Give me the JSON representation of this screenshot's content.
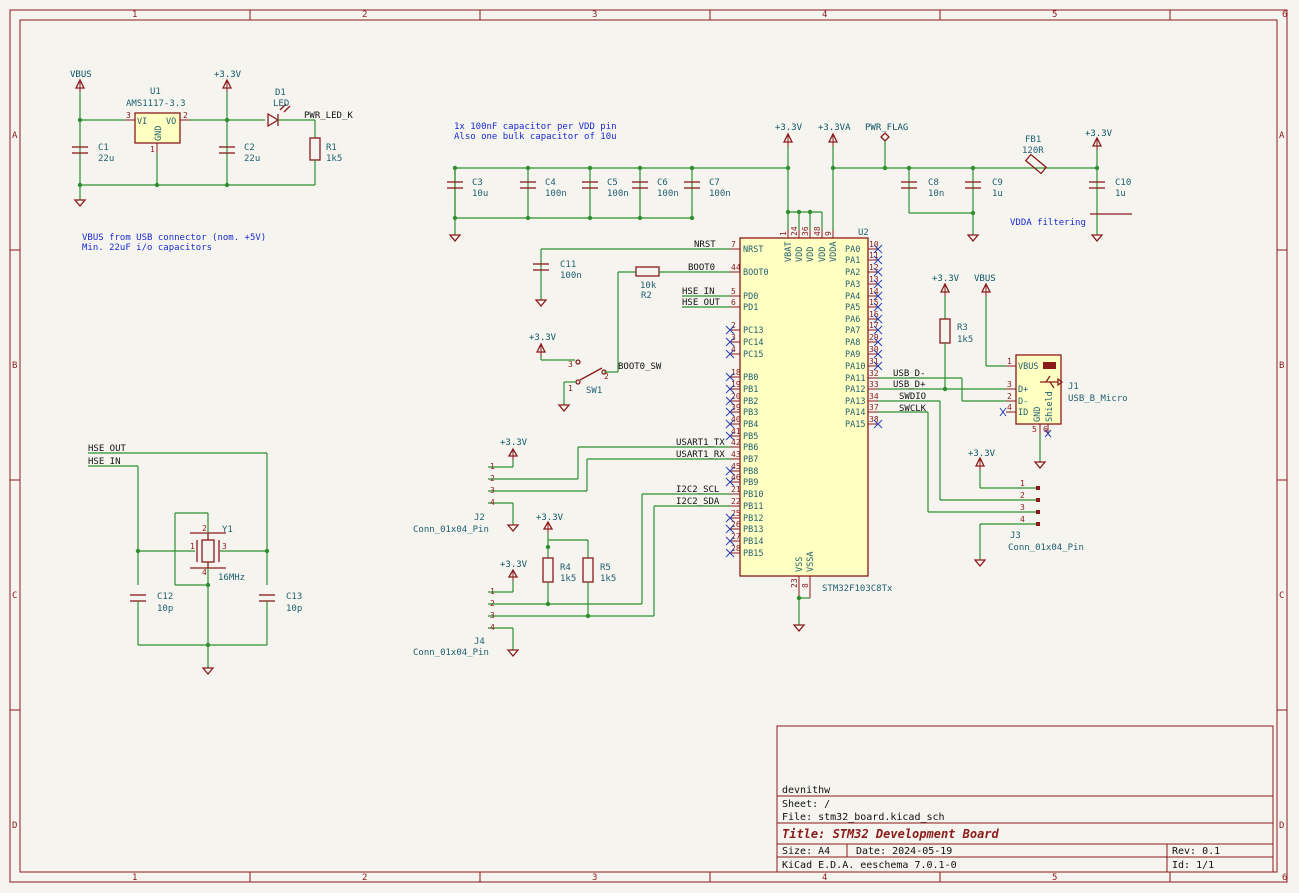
{
  "sheet_border": {
    "columns": [
      "1",
      "2",
      "3",
      "4",
      "5",
      "6"
    ],
    "rows": [
      "A",
      "B",
      "C",
      "D"
    ]
  },
  "power_section": {
    "vbus_label": "VBUS",
    "v33_label": "+3.3V",
    "u1_ref": "U1",
    "u1_value": "AMS1117-3.3",
    "u1_pin_vi": "VI",
    "u1_pin_vo": "VO",
    "u1_pin_gnd": "GND",
    "u1_pin3": "3",
    "u1_pin2": "2",
    "u1_pin1": "1",
    "c1_ref": "C1",
    "c1_val": "22u",
    "c2_ref": "C2",
    "c2_val": "22u",
    "d1_ref": "D1",
    "d1_val": "LED",
    "r1_ref": "R1",
    "r1_val": "1k5",
    "led_net": "PWR_LED_K",
    "note_line1": "VBUS from USB connector (nom. +5V)",
    "note_line2": "Min. 22uF i/o capacitors"
  },
  "decoupling": {
    "note_line1": "1x 100nF capacitor per VDD pin",
    "note_line2": "Also one bulk capacitor of 10u",
    "c3_ref": "C3",
    "c3_val": "10u",
    "c4_ref": "C4",
    "c4_val": "100n",
    "c5_ref": "C5",
    "c5_val": "100n",
    "c6_ref": "C6",
    "c6_val": "100n",
    "c7_ref": "C7",
    "c7_val": "100n",
    "v33_label": "+3.3V",
    "v33a_label": "+3.3VA",
    "pwr_flag": "PWR_FLAG",
    "c8_ref": "C8",
    "c8_val": "10n",
    "c9_ref": "C9",
    "c9_val": "1u",
    "fb1_ref": "FB1",
    "fb1_val": "120R",
    "c10_ref": "C10",
    "c10_val": "1u",
    "v33_right": "+3.3V",
    "vdda_note": "VDDA filtering"
  },
  "mcu": {
    "ref": "U2",
    "value": "STM32F103C8Tx",
    "top_pins": [
      {
        "name": "VBAT",
        "num": "1"
      },
      {
        "name": "VDD",
        "num": "24"
      },
      {
        "name": "VDD",
        "num": "36"
      },
      {
        "name": "VDD",
        "num": "48"
      },
      {
        "name": "VDDA",
        "num": "9"
      }
    ],
    "bottom_pins": [
      {
        "name": "VSS",
        "num": "23"
      },
      {
        "name": "VSSA",
        "num": "8"
      }
    ],
    "left_pins": [
      {
        "name": "NRST",
        "num": "7",
        "net": "NRST"
      },
      {
        "name": "BOOT0",
        "num": "44",
        "net": "BOOT0"
      },
      {
        "name": "PD0",
        "num": "5",
        "net": "HSE_IN"
      },
      {
        "name": "PD1",
        "num": "6",
        "net": "HSE_OUT"
      },
      {
        "name": "PC13",
        "num": "2",
        "net": ""
      },
      {
        "name": "PC14",
        "num": "3",
        "net": ""
      },
      {
        "name": "PC15",
        "num": "4",
        "net": ""
      },
      {
        "name": "PB0",
        "num": "18",
        "net": ""
      },
      {
        "name": "PB1",
        "num": "19",
        "net": ""
      },
      {
        "name": "PB2",
        "num": "20",
        "net": ""
      },
      {
        "name": "PB3",
        "num": "39",
        "net": ""
      },
      {
        "name": "PB4",
        "num": "40",
        "net": ""
      },
      {
        "name": "PB5",
        "num": "41",
        "net": ""
      },
      {
        "name": "PB6",
        "num": "42",
        "net": "USART1_TX"
      },
      {
        "name": "PB7",
        "num": "43",
        "net": "USART1_RX"
      },
      {
        "name": "PB8",
        "num": "45",
        "net": ""
      },
      {
        "name": "PB9",
        "num": "46",
        "net": ""
      },
      {
        "name": "PB10",
        "num": "21",
        "net": "I2C2_SCL"
      },
      {
        "name": "PB11",
        "num": "22",
        "net": "I2C2_SDA"
      },
      {
        "name": "PB12",
        "num": "25",
        "net": ""
      },
      {
        "name": "PB13",
        "num": "26",
        "net": ""
      },
      {
        "name": "PB14",
        "num": "27",
        "net": ""
      },
      {
        "name": "PB15",
        "num": "28",
        "net": ""
      }
    ],
    "right_pins": [
      {
        "name": "PA0",
        "num": "10",
        "net": ""
      },
      {
        "name": "PA1",
        "num": "11",
        "net": ""
      },
      {
        "name": "PA2",
        "num": "12",
        "net": ""
      },
      {
        "name": "PA3",
        "num": "13",
        "net": ""
      },
      {
        "name": "PA4",
        "num": "14",
        "net": ""
      },
      {
        "name": "PA5",
        "num": "15",
        "net": ""
      },
      {
        "name": "PA6",
        "num": "16",
        "net": ""
      },
      {
        "name": "PA7",
        "num": "17",
        "net": ""
      },
      {
        "name": "PA8",
        "num": "29",
        "net": ""
      },
      {
        "name": "PA9",
        "num": "30",
        "net": ""
      },
      {
        "name": "PA10",
        "num": "31",
        "net": ""
      },
      {
        "name": "PA11",
        "num": "32",
        "net": "USB_D-"
      },
      {
        "name": "PA12",
        "num": "33",
        "net": "USB_D+"
      },
      {
        "name": "PA13",
        "num": "34",
        "net": "SWDIO"
      },
      {
        "name": "PA14",
        "num": "37",
        "net": "SWCLK"
      },
      {
        "name": "PA15",
        "num": "38",
        "net": ""
      }
    ]
  },
  "reset_boot": {
    "c11_ref": "C11",
    "c11_val": "100n",
    "r2_ref": "R2",
    "r2_val": "10k",
    "v33_label": "+3.3V",
    "sw1_ref": "SW1",
    "sw_net": "BOOT0_SW",
    "sw_pin1": "1",
    "sw_pin2": "2",
    "sw_pin3": "3"
  },
  "connectors": {
    "j2_ref": "J2",
    "j2_val": "Conn_01x04_Pin",
    "j3_ref": "J3",
    "j3_val": "Conn_01x04_Pin",
    "j4_ref": "J4",
    "j4_val": "Conn_01x04_Pin",
    "v33_label": "+3.3V",
    "r4_ref": "R4",
    "r4_val": "1k5",
    "r5_ref": "R5",
    "r5_val": "1k5",
    "pins": [
      "1",
      "2",
      "3",
      "4"
    ]
  },
  "usb": {
    "r3_ref": "R3",
    "r3_val": "1k5",
    "v33_label": "+3.3V",
    "vbus_label": "VBUS",
    "j1_ref": "J1",
    "j1_val": "USB_B_Micro",
    "pin_vbus": "VBUS",
    "pin_dp": "D+",
    "pin_dm": "D-",
    "pin_id": "ID",
    "pin_gnd": "GND",
    "pin_shield": "Shield",
    "pin_nums": [
      "1",
      "3",
      "2",
      "4",
      "5",
      "6"
    ]
  },
  "crystal": {
    "hse_out": "HSE_OUT",
    "hse_in": "HSE_IN",
    "y1_ref": "Y1",
    "y1_val": "16MHz",
    "c12_ref": "C12",
    "c12_val": "10p",
    "c13_ref": "C13",
    "c13_val": "10p",
    "y_pins": [
      "1",
      "2",
      "3",
      "4"
    ]
  },
  "title_block": {
    "company": "devnithw",
    "sheet": "Sheet: /",
    "file": "File: stm32_board.kicad_sch",
    "title": "Title: STM32 Development Board",
    "size": "Size: A4",
    "date": "Date: 2024-05-19",
    "rev": "Rev: 0.1",
    "tool": "KiCad E.D.A.  eeschema 7.0.1-0",
    "id": "Id: 1/1"
  }
}
